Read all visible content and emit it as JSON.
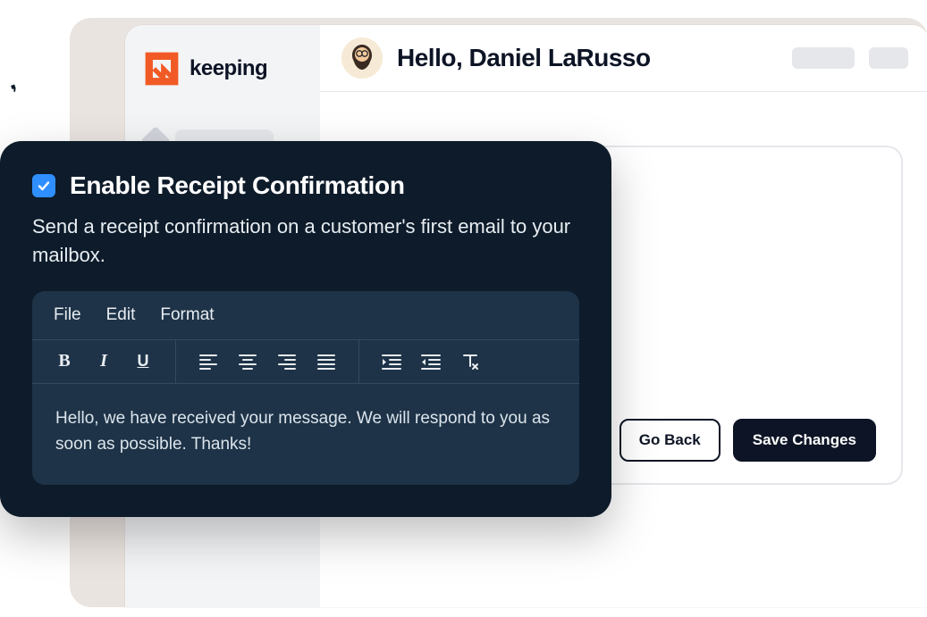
{
  "brand": {
    "name": "keeping"
  },
  "header": {
    "greeting": "Hello, Daniel LaRusso"
  },
  "content": {
    "buttons": {
      "back": "Go Back",
      "save": "Save Changes"
    }
  },
  "overlay": {
    "checkbox_checked": true,
    "title": "Enable Receipt Confirmation",
    "description": "Send a receipt confirmation on a customer's first email to your mailbox.",
    "editor": {
      "menus": {
        "file": "File",
        "edit": "Edit",
        "format": "Format"
      },
      "body": "Hello, we have received your message. We will respond to you as soon as possible. Thanks!"
    }
  },
  "icons": {
    "logo": "keeping-logo",
    "avatar": "avatar",
    "check": "check-icon",
    "bold": "bold-icon",
    "italic": "italic-icon",
    "underline": "underline-icon",
    "align_left": "align-left-icon",
    "align_center": "align-center-icon",
    "align_right": "align-right-icon",
    "align_justify": "align-justify-icon",
    "indent": "indent-icon",
    "outdent": "outdent-icon",
    "clear_format": "clear-format-icon"
  },
  "colors": {
    "overlay_bg": "#0d1b2a",
    "editor_bg": "#1e3347",
    "accent_blue": "#2f8fff",
    "brand_orange": "#f15a24",
    "text_dark": "#0d1425"
  }
}
